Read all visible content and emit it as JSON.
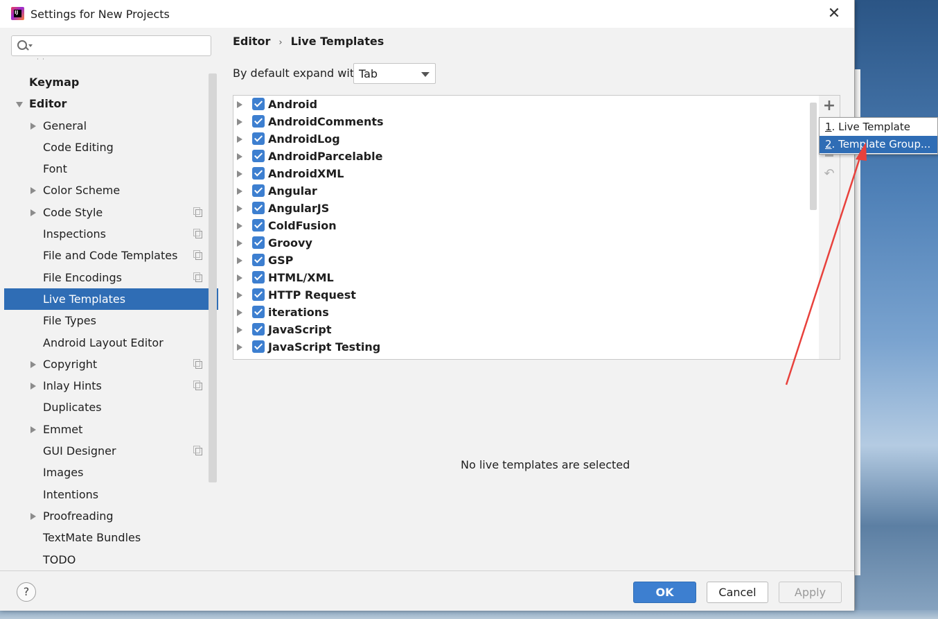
{
  "window": {
    "title": "Settings for New Projects",
    "close_glyph": "✕"
  },
  "sidebar": {
    "search_placeholder": "",
    "items": [
      {
        "label": "Keymap",
        "level": 0,
        "bold": true,
        "expander": "none",
        "copy": false
      },
      {
        "label": "Editor",
        "level": 0,
        "bold": true,
        "expander": "down",
        "copy": false
      },
      {
        "label": "General",
        "level": 1,
        "bold": false,
        "expander": "right",
        "copy": false
      },
      {
        "label": "Code Editing",
        "level": 1,
        "bold": false,
        "expander": "none",
        "copy": false
      },
      {
        "label": "Font",
        "level": 1,
        "bold": false,
        "expander": "none",
        "copy": false
      },
      {
        "label": "Color Scheme",
        "level": 1,
        "bold": false,
        "expander": "right",
        "copy": false
      },
      {
        "label": "Code Style",
        "level": 1,
        "bold": false,
        "expander": "right",
        "copy": true
      },
      {
        "label": "Inspections",
        "level": 1,
        "bold": false,
        "expander": "none",
        "copy": true
      },
      {
        "label": "File and Code Templates",
        "level": 1,
        "bold": false,
        "expander": "none",
        "copy": true
      },
      {
        "label": "File Encodings",
        "level": 1,
        "bold": false,
        "expander": "none",
        "copy": true
      },
      {
        "label": "Live Templates",
        "level": 1,
        "bold": false,
        "expander": "none",
        "copy": false,
        "selected": true
      },
      {
        "label": "File Types",
        "level": 1,
        "bold": false,
        "expander": "none",
        "copy": false
      },
      {
        "label": "Android Layout Editor",
        "level": 1,
        "bold": false,
        "expander": "none",
        "copy": false
      },
      {
        "label": "Copyright",
        "level": 1,
        "bold": false,
        "expander": "right",
        "copy": true
      },
      {
        "label": "Inlay Hints",
        "level": 1,
        "bold": false,
        "expander": "right",
        "copy": true
      },
      {
        "label": "Duplicates",
        "level": 1,
        "bold": false,
        "expander": "none",
        "copy": false
      },
      {
        "label": "Emmet",
        "level": 1,
        "bold": false,
        "expander": "right",
        "copy": false
      },
      {
        "label": "GUI Designer",
        "level": 1,
        "bold": false,
        "expander": "none",
        "copy": true
      },
      {
        "label": "Images",
        "level": 1,
        "bold": false,
        "expander": "none",
        "copy": false
      },
      {
        "label": "Intentions",
        "level": 1,
        "bold": false,
        "expander": "none",
        "copy": false
      },
      {
        "label": "Proofreading",
        "level": 1,
        "bold": false,
        "expander": "right",
        "copy": false
      },
      {
        "label": "TextMate Bundles",
        "level": 1,
        "bold": false,
        "expander": "none",
        "copy": false
      },
      {
        "label": "TODO",
        "level": 1,
        "bold": false,
        "expander": "none",
        "copy": false
      }
    ]
  },
  "main": {
    "breadcrumb": {
      "parent": "Editor",
      "separator": "›",
      "current": "Live Templates"
    },
    "expand_label": "By default expand with",
    "expand_value": "Tab",
    "template_groups": [
      {
        "name": "Android",
        "checked": true
      },
      {
        "name": "AndroidComments",
        "checked": true
      },
      {
        "name": "AndroidLog",
        "checked": true
      },
      {
        "name": "AndroidParcelable",
        "checked": true
      },
      {
        "name": "AndroidXML",
        "checked": true
      },
      {
        "name": "Angular",
        "checked": true
      },
      {
        "name": "AngularJS",
        "checked": true
      },
      {
        "name": "ColdFusion",
        "checked": true
      },
      {
        "name": "Groovy",
        "checked": true
      },
      {
        "name": "GSP",
        "checked": true
      },
      {
        "name": "HTML/XML",
        "checked": true
      },
      {
        "name": "HTTP Request",
        "checked": true
      },
      {
        "name": "iterations",
        "checked": true
      },
      {
        "name": "JavaScript",
        "checked": true
      },
      {
        "name": "JavaScript Testing",
        "checked": true
      }
    ],
    "toolbar": {
      "add_glyph": "+",
      "undo_glyph": "↶"
    },
    "empty_message": "No live templates are selected"
  },
  "popup_menu": {
    "items": [
      {
        "mnemonic": "1",
        "label": ". Live Template",
        "active": false
      },
      {
        "mnemonic": "2",
        "label": ". Template Group...",
        "active": true
      }
    ]
  },
  "footer": {
    "help_glyph": "?",
    "ok_label": "OK",
    "cancel_label": "Cancel",
    "apply_label": "Apply",
    "apply_enabled": false
  },
  "colors": {
    "accent": "#2f6db5",
    "checkbox": "#3d7fd0",
    "annotation_arrow": "#e8413c"
  },
  "icons": {
    "app": "intellij-idea-icon",
    "search": "search-icon",
    "help": "help-icon",
    "add": "add-icon",
    "remove": "remove-icon",
    "undo": "undo-icon",
    "close": "close-icon"
  }
}
